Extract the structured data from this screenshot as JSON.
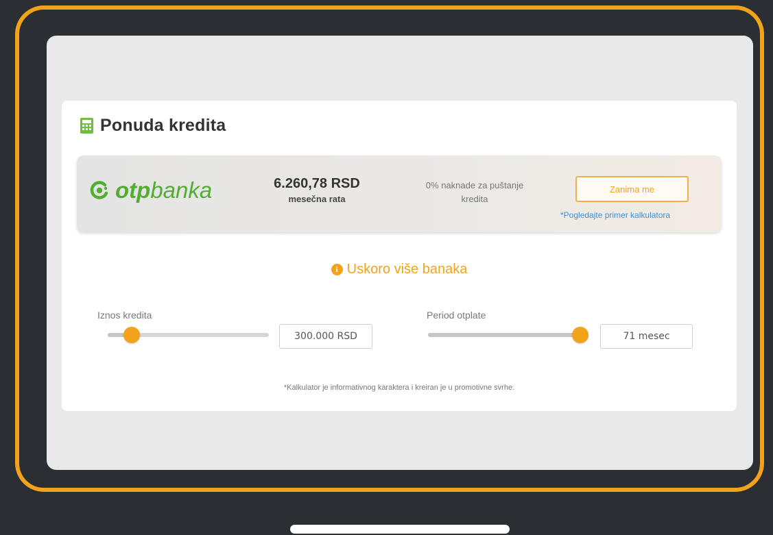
{
  "header": {
    "title": "Ponuda kredita",
    "title_icon": "calculator-icon"
  },
  "offer": {
    "bank_logo": {
      "part1": "otp",
      "part2": "banka"
    },
    "monthly_amount": "6.260,78 RSD",
    "monthly_label": "mesečna rata",
    "fee_line1": "0% naknade za puštanje",
    "fee_line2": "kredita",
    "cta_label": "Zanima me",
    "example_link": "*Pogledajte primer kalkulatora"
  },
  "notice": {
    "icon": "info-icon",
    "text": "Uskoro više banaka"
  },
  "loan_amount": {
    "label": "Iznos kredita",
    "value": "300.000 RSD",
    "slider_fraction": 0.15
  },
  "repayment_period": {
    "label": "Period otplate",
    "value": "71 mesec",
    "slider_fraction": 1.0
  },
  "disclaimer": "*Kalkulator je informativnog karaktera i kreiran je u promotivne svrhe.",
  "colors": {
    "accent": "#f3a21c",
    "brand_green": "#52ae30",
    "link": "#3d8fd6"
  }
}
